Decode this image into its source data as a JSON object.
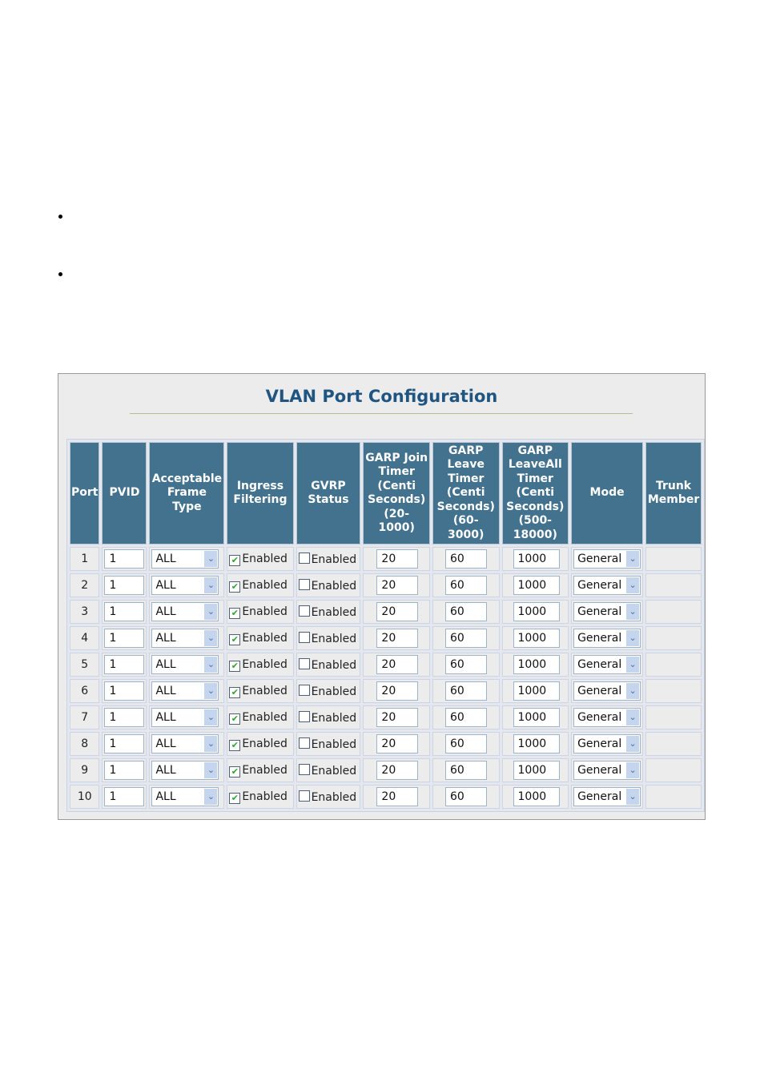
{
  "page": {
    "bullets": 2
  },
  "panel": {
    "title": "VLAN Port Configuration",
    "columns": [
      "Port",
      "PVID",
      "Acceptable Frame Type",
      "Ingress Filtering",
      "GVRP Status",
      "GARP Join Timer (Centi Seconds) (20- 1000)",
      "GARP Leave Timer (Centi Seconds) (60- 3000)",
      "GARP LeaveAll Timer (Centi Seconds) (500- 18000)",
      "Mode",
      "Trunk Member"
    ],
    "rows": [
      {
        "port": "1",
        "pvid": "1",
        "frame_type": "ALL",
        "ingress_checked": true,
        "ingress_label": "Enabled",
        "gvrp_checked": false,
        "gvrp_label": "Enabled",
        "join": "20",
        "leave": "60",
        "leaveall": "1000",
        "mode": "General",
        "trunk": ""
      },
      {
        "port": "2",
        "pvid": "1",
        "frame_type": "ALL",
        "ingress_checked": true,
        "ingress_label": "Enabled",
        "gvrp_checked": false,
        "gvrp_label": "Enabled",
        "join": "20",
        "leave": "60",
        "leaveall": "1000",
        "mode": "General",
        "trunk": ""
      },
      {
        "port": "3",
        "pvid": "1",
        "frame_type": "ALL",
        "ingress_checked": true,
        "ingress_label": "Enabled",
        "gvrp_checked": false,
        "gvrp_label": "Enabled",
        "join": "20",
        "leave": "60",
        "leaveall": "1000",
        "mode": "General",
        "trunk": ""
      },
      {
        "port": "4",
        "pvid": "1",
        "frame_type": "ALL",
        "ingress_checked": true,
        "ingress_label": "Enabled",
        "gvrp_checked": false,
        "gvrp_label": "Enabled",
        "join": "20",
        "leave": "60",
        "leaveall": "1000",
        "mode": "General",
        "trunk": ""
      },
      {
        "port": "5",
        "pvid": "1",
        "frame_type": "ALL",
        "ingress_checked": true,
        "ingress_label": "Enabled",
        "gvrp_checked": false,
        "gvrp_label": "Enabled",
        "join": "20",
        "leave": "60",
        "leaveall": "1000",
        "mode": "General",
        "trunk": ""
      },
      {
        "port": "6",
        "pvid": "1",
        "frame_type": "ALL",
        "ingress_checked": true,
        "ingress_label": "Enabled",
        "gvrp_checked": false,
        "gvrp_label": "Enabled",
        "join": "20",
        "leave": "60",
        "leaveall": "1000",
        "mode": "General",
        "trunk": ""
      },
      {
        "port": "7",
        "pvid": "1",
        "frame_type": "ALL",
        "ingress_checked": true,
        "ingress_label": "Enabled",
        "gvrp_checked": false,
        "gvrp_label": "Enabled",
        "join": "20",
        "leave": "60",
        "leaveall": "1000",
        "mode": "General",
        "trunk": ""
      },
      {
        "port": "8",
        "pvid": "1",
        "frame_type": "ALL",
        "ingress_checked": true,
        "ingress_label": "Enabled",
        "gvrp_checked": false,
        "gvrp_label": "Enabled",
        "join": "20",
        "leave": "60",
        "leaveall": "1000",
        "mode": "General",
        "trunk": ""
      },
      {
        "port": "9",
        "pvid": "1",
        "frame_type": "ALL",
        "ingress_checked": true,
        "ingress_label": "Enabled",
        "gvrp_checked": false,
        "gvrp_label": "Enabled",
        "join": "20",
        "leave": "60",
        "leaveall": "1000",
        "mode": "General",
        "trunk": ""
      },
      {
        "port": "10",
        "pvid": "1",
        "frame_type": "ALL",
        "ingress_checked": true,
        "ingress_label": "Enabled",
        "gvrp_checked": false,
        "gvrp_label": "Enabled",
        "join": "20",
        "leave": "60",
        "leaveall": "1000",
        "mode": "General",
        "trunk": ""
      }
    ],
    "icons": {
      "dropdown": "chevron-down-icon",
      "check": "✔"
    }
  }
}
